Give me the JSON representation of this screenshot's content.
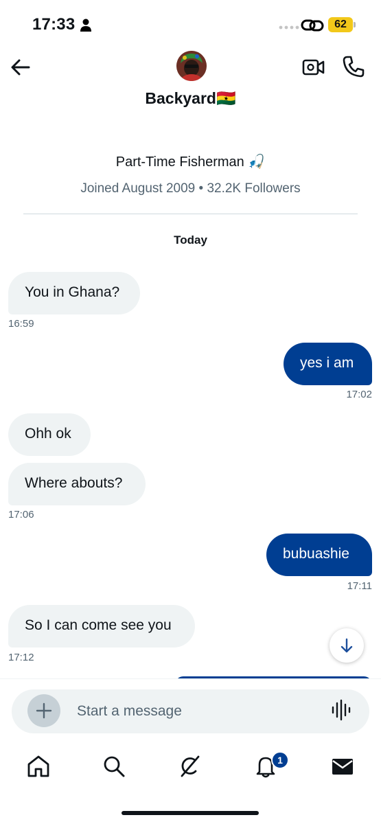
{
  "status_bar": {
    "time": "17:33",
    "battery": "62",
    "battery_color": "#f2c81a"
  },
  "header": {
    "back_icon": "arrow-left-icon",
    "name": "Backyard🇬🇭",
    "video_icon": "video-camera-icon",
    "phone_icon": "phone-icon"
  },
  "profile": {
    "bio": "Part-Time Fisherman 🎣",
    "meta": "Joined August 2009 • 32.2K Followers"
  },
  "conversation": {
    "date_label": "Today",
    "messages": [
      {
        "direction": "incoming",
        "text": "You in Ghana?",
        "time": "16:59"
      },
      {
        "direction": "outgoing",
        "text": "yes i am",
        "time": "17:02"
      },
      {
        "direction": "incoming",
        "text": "Ohh ok",
        "time": ""
      },
      {
        "direction": "incoming",
        "text": "Where abouts?",
        "time": "17:06"
      },
      {
        "direction": "outgoing",
        "text": "bubuashie",
        "time": "17:11"
      },
      {
        "direction": "incoming",
        "text": "So I can come see you",
        "time": "17:12"
      }
    ]
  },
  "composer": {
    "placeholder": "Start a message"
  },
  "tab_bar": {
    "items": [
      "home-icon",
      "search-icon",
      "grok-icon",
      "bell-icon",
      "envelope-icon"
    ],
    "notification_count": "1"
  },
  "colors": {
    "outgoing_bubble": "#003e92",
    "incoming_bubble": "#eff3f4",
    "secondary_text": "#536471"
  }
}
